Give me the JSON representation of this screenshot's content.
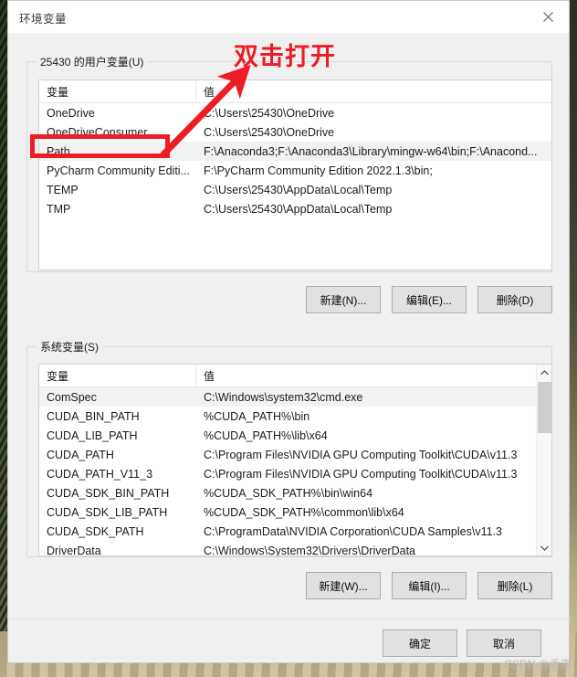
{
  "window": {
    "title": "环境变量",
    "close_icon": "close-icon"
  },
  "user_section": {
    "legend": "25430 的用户变量(U)",
    "columns": [
      "变量",
      "值"
    ],
    "rows": [
      {
        "name": "OneDrive",
        "value": "C:\\Users\\25430\\OneDrive",
        "selected": false
      },
      {
        "name": "OneDriveConsumer",
        "value": "C:\\Users\\25430\\OneDrive",
        "selected": false
      },
      {
        "name": "Path",
        "value": "F:\\Anaconda3;F:\\Anaconda3\\Library\\mingw-w64\\bin;F:\\Anacond...",
        "selected": true
      },
      {
        "name": "PyCharm Community Editi...",
        "value": "F:\\PyCharm Community Edition 2022.1.3\\bin;",
        "selected": false
      },
      {
        "name": "TEMP",
        "value": "C:\\Users\\25430\\AppData\\Local\\Temp",
        "selected": false
      },
      {
        "name": "TMP",
        "value": "C:\\Users\\25430\\AppData\\Local\\Temp",
        "selected": false
      }
    ],
    "buttons": {
      "new": "新建(N)...",
      "edit": "编辑(E)...",
      "delete": "删除(D)"
    }
  },
  "system_section": {
    "legend": "系统变量(S)",
    "columns": [
      "变量",
      "值"
    ],
    "rows": [
      {
        "name": "ComSpec",
        "value": "C:\\Windows\\system32\\cmd.exe",
        "selected": true
      },
      {
        "name": "CUDA_BIN_PATH",
        "value": "%CUDA_PATH%\\bin",
        "selected": false
      },
      {
        "name": "CUDA_LIB_PATH",
        "value": "%CUDA_PATH%\\lib\\x64",
        "selected": false
      },
      {
        "name": "CUDA_PATH",
        "value": "C:\\Program Files\\NVIDIA GPU Computing Toolkit\\CUDA\\v11.3",
        "selected": false
      },
      {
        "name": "CUDA_PATH_V11_3",
        "value": "C:\\Program Files\\NVIDIA GPU Computing Toolkit\\CUDA\\v11.3",
        "selected": false
      },
      {
        "name": "CUDA_SDK_BIN_PATH",
        "value": "%CUDA_SDK_PATH%\\bin\\win64",
        "selected": false
      },
      {
        "name": "CUDA_SDK_LIB_PATH",
        "value": "%CUDA_SDK_PATH%\\common\\lib\\x64",
        "selected": false
      },
      {
        "name": "CUDA_SDK_PATH",
        "value": "C:\\ProgramData\\NVIDIA Corporation\\CUDA Samples\\v11.3",
        "selected": false
      },
      {
        "name": "DriverData",
        "value": "C:\\Windows\\System32\\Drivers\\DriverData",
        "selected": false
      }
    ],
    "buttons": {
      "new": "新建(W)...",
      "edit": "编辑(I)...",
      "delete": "删除(L)"
    },
    "scrollbar": {
      "up_icon": "chevron-up-icon",
      "down_icon": "chevron-down-icon"
    }
  },
  "footer": {
    "ok": "确定",
    "cancel": "取消"
  },
  "annotations": {
    "callout_text": "双击打开",
    "arrow_color": "#ee1c25",
    "highlight_color": "#ee1c25"
  },
  "watermark": {
    "text": "CSDN @香离"
  }
}
